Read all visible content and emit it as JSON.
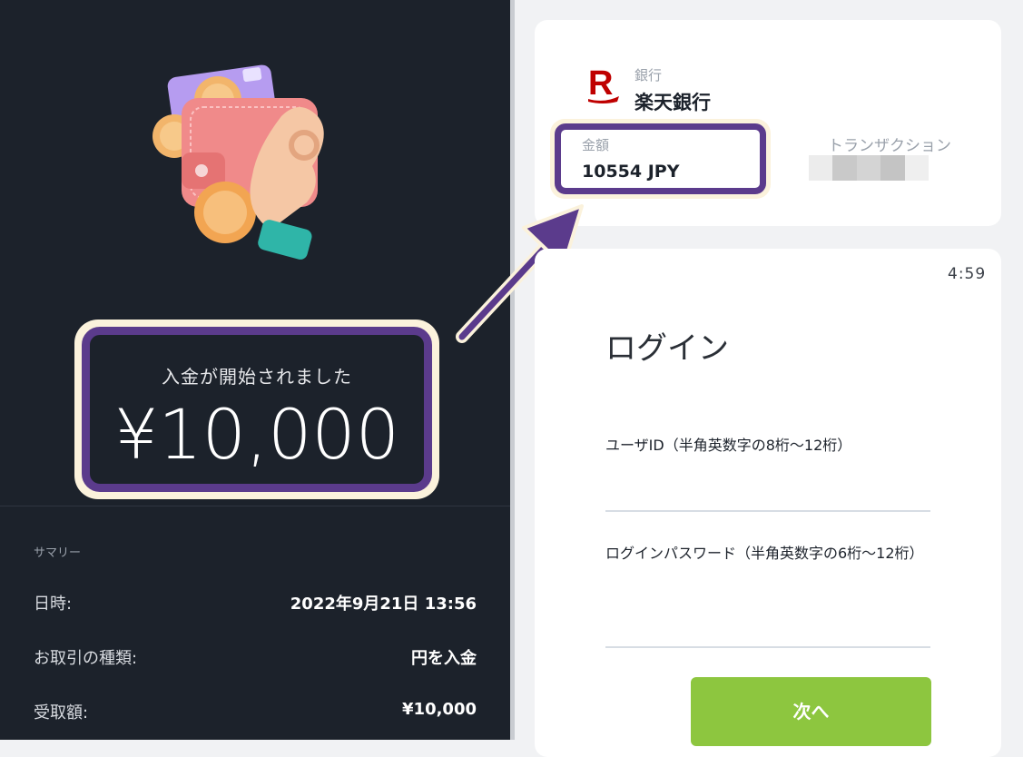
{
  "deposit": {
    "title": "入金が開始されました",
    "amount": "¥10,000"
  },
  "summary": {
    "label": "サマリー",
    "rows": [
      {
        "key": "日時:",
        "value": "2022年9月21日 13:56"
      },
      {
        "key": "お取引の種類:",
        "value": "円を入金"
      },
      {
        "key": "受取額:",
        "value": "¥10,000"
      }
    ]
  },
  "bank": {
    "label": "銀行",
    "name": "楽天銀行",
    "logo_letter": "R"
  },
  "amount_box": {
    "label": "金額",
    "value": "10554 JPY"
  },
  "transaction": {
    "label": "トランザクション"
  },
  "login": {
    "timer": "4:59",
    "title": "ログイン",
    "user_id_label": "ユーザID（半角英数字の8桁〜12桁）",
    "password_label": "ログインパスワード（半角英数字の6桁〜12桁）",
    "next_button": "次へ"
  },
  "colors": {
    "left_bg": "#1c222b",
    "highlight_border": "#5b3b8c",
    "highlight_glow": "#fbf2dc",
    "button_green": "#8dc63f",
    "rakuten_red": "#bf0000"
  }
}
